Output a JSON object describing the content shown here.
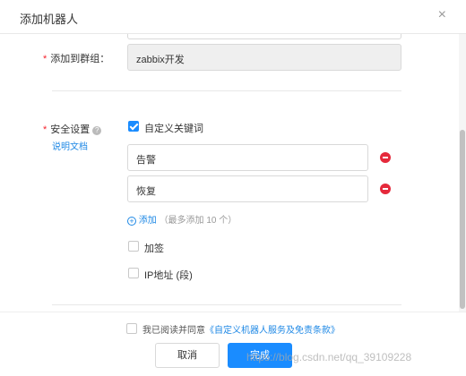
{
  "dialog": {
    "title": "添加机器人",
    "close_icon": "×"
  },
  "group": {
    "label": "添加到群组：",
    "value": "zabbix开发"
  },
  "security": {
    "label": "安全设置",
    "help_icon": "?",
    "doc_link": "说明文档",
    "custom_keyword": {
      "label": "自定义关键词",
      "checked": true
    },
    "keywords": [
      "告警",
      "恢复"
    ],
    "add_label": "添加",
    "add_hint": "（最多添加 10 个）",
    "sign": {
      "label": "加签",
      "checked": false
    },
    "ip": {
      "label": "IP地址 (段)",
      "checked": false
    }
  },
  "footer": {
    "agree_text": "我已阅读并同意",
    "agree_link": "《自定义机器人服务及免责条款》",
    "cancel_label": "取消",
    "done_label": "完成"
  },
  "watermark": "https://blog.csdn.net/qq_39109228",
  "colors": {
    "primary": "#1a8cff",
    "link": "#1e88e5",
    "danger": "#e5293b",
    "required": "#f5222d"
  }
}
